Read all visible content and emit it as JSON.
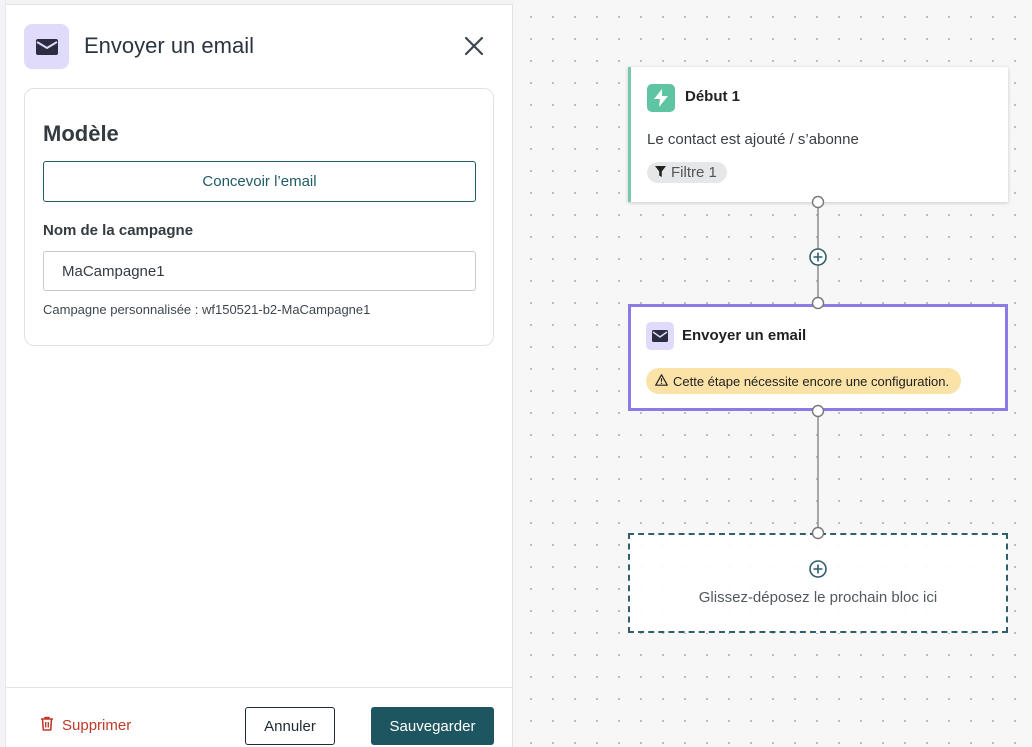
{
  "panel": {
    "title": "Envoyer un email",
    "icon": "envelope-icon",
    "card": {
      "title": "Modèle",
      "design_button": "Concevoir l’email",
      "name_label": "Nom de la campagne",
      "name_value": "MaCampagne1",
      "hint": "Campagne personnalisée : wf150521-b2-MaCampagne1"
    },
    "footer": {
      "delete_label": "Supprimer",
      "cancel_label": "Annuler",
      "save_label": "Sauvegarder"
    }
  },
  "canvas": {
    "start_node": {
      "title": "Début 1",
      "description": "Le contact est ajouté / s’abonne",
      "filter_label": "Filtre 1",
      "icon": "lightning-icon"
    },
    "email_node": {
      "title": "Envoyer un email",
      "warning": "Cette étape nécessite encore une configuration.",
      "icon": "envelope-icon"
    },
    "drop_zone": {
      "label": "Glissez-déposez le prochain bloc ici"
    }
  },
  "colors": {
    "primary": "#1d5560",
    "accent_purple": "#8c7ae6",
    "start_green": "#5ec4a1",
    "warning_bg": "#fbe3a8",
    "danger": "#c0392b"
  }
}
